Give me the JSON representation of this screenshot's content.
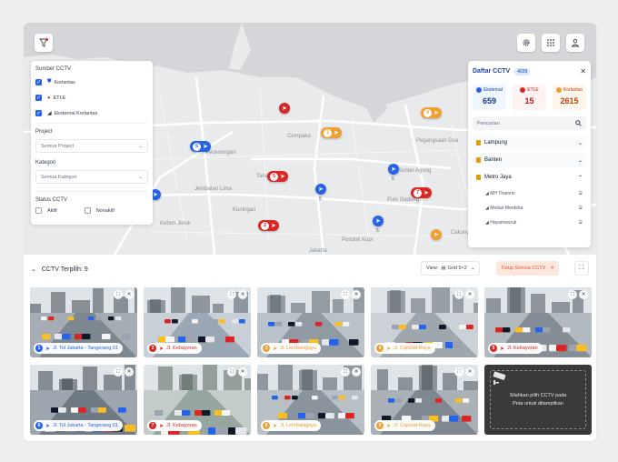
{
  "colors": {
    "korlantas": "#2563eb",
    "etle": "#dc2626",
    "eksternal": "#f0a030",
    "accent": "#1e40af"
  },
  "map": {
    "labels": [
      "Pecenongan",
      "Jembatan Lima",
      "Kebon Jeruk",
      "Kuningan",
      "Cempaka",
      "Sunter Agung",
      "Pegangsaan Dua",
      "Cakung",
      "Pondok Kopi",
      "Pulo Gadung",
      "Tanah Abang",
      "Jakarta"
    ],
    "markers": [
      {
        "num": "5",
        "sub": "",
        "type": "korlantas"
      },
      {
        "num": "",
        "sub": "",
        "type": "etle"
      },
      {
        "num": "3",
        "sub": "",
        "type": "eksternal"
      },
      {
        "num": "4",
        "sub": "",
        "type": "eksternal"
      },
      {
        "num": "5",
        "sub": "",
        "type": "etle"
      },
      {
        "num": "",
        "sub": "5",
        "type": "korlantas"
      },
      {
        "num": "",
        "sub": "5",
        "type": "korlantas"
      },
      {
        "num": "7",
        "sub": "",
        "type": "etle"
      },
      {
        "num": "2",
        "sub": "",
        "type": "etle"
      },
      {
        "num": "",
        "sub": "5",
        "type": "korlantas"
      },
      {
        "num": "",
        "sub": "",
        "type": "eksternal"
      },
      {
        "num": "",
        "sub": "",
        "type": "korlantas"
      }
    ]
  },
  "filter": {
    "sumber_title": "Sumber CCTV",
    "sources": [
      {
        "label": "Korlantas",
        "checked": true
      },
      {
        "label": "ETLE",
        "checked": true
      },
      {
        "label": "Eksternal Korlantas",
        "checked": true
      }
    ],
    "project_title": "Project",
    "project_value": "Semua Project",
    "kategori_title": "Kategori",
    "kategori_value": "Semua Kategori",
    "status_title": "Status CCTV",
    "status_aktif": "Aktif",
    "status_nonaktif": "Nonaktif"
  },
  "list": {
    "title": "Daftar CCTV",
    "count": "4039",
    "stats": [
      {
        "label": "Eksternal",
        "value": "659"
      },
      {
        "label": "ETLE",
        "value": "15"
      },
      {
        "label": "Korlantas",
        "value": "2615"
      }
    ],
    "search_placeholder": "Pencarian",
    "regions": [
      {
        "name": "Lampung"
      },
      {
        "name": "Banten"
      },
      {
        "name": "Metro Jaya"
      }
    ],
    "sub_items": [
      "MH Thamrin",
      "Medan Merdeka",
      "Hayamwuruk"
    ]
  },
  "bottom": {
    "selected_label": "CCTV Terpilih: 9",
    "view_label": "View:",
    "grid_label": "Grid 5×2",
    "close_all": "Tutup Semua CCTV"
  },
  "tiles": [
    {
      "num": "1",
      "type": "korlantas",
      "name": "Jl. Tol Jakarta - Tangerang 01"
    },
    {
      "num": "2",
      "type": "etle",
      "name": "Jl. Kebayoran"
    },
    {
      "num": "3",
      "type": "eksternal",
      "name": "Jl. Lembangjaya"
    },
    {
      "num": "4",
      "type": "eksternal",
      "name": "Jl. Caputat Raya"
    },
    {
      "num": "5",
      "type": "etle",
      "name": "Jl. Kebayoran"
    },
    {
      "num": "6",
      "type": "korlantas",
      "name": "Jl. Tol Jakarta - Tangerang 01"
    },
    {
      "num": "7",
      "type": "etle",
      "name": "Jl. Kebayoran"
    },
    {
      "num": "8",
      "type": "eksternal",
      "name": "Jl. Lembangjaya"
    },
    {
      "num": "9",
      "type": "eksternal",
      "name": "Jl. Caputat Raya"
    }
  ],
  "empty_tile": {
    "line1": "Silahkan pilih CCTV pada",
    "line2": "Peta untuk ditampilkan"
  }
}
